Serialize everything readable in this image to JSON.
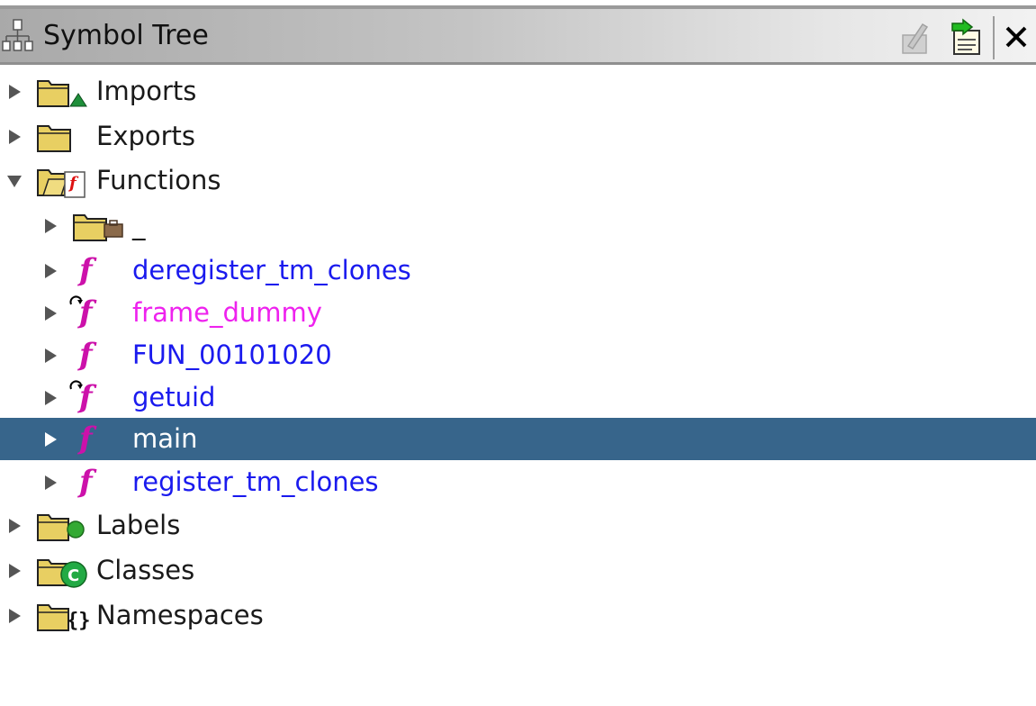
{
  "window": {
    "title": "Symbol Tree"
  },
  "toolbar": {
    "icons": [
      "edit-icon",
      "navigate-icon",
      "close-icon"
    ],
    "close_glyph": "✕"
  },
  "tree": {
    "imports": {
      "label": "Imports",
      "icon": "imports-folder-icon",
      "state": "collapsed"
    },
    "exports": {
      "label": "Exports",
      "icon": "exports-folder-icon",
      "state": "collapsed"
    },
    "functions": {
      "label": "Functions",
      "icon": "functions-folder-icon",
      "state": "expanded",
      "children": [
        {
          "label": "_",
          "kind": "folder",
          "icon": "package-folder-icon"
        },
        {
          "label": "deregister_tm_clones",
          "kind": "function",
          "icon": "function-icon",
          "color": "#1a1aee"
        },
        {
          "label": "frame_dummy",
          "kind": "thunk",
          "icon": "thunk-function-icon",
          "color": "#ee22ee"
        },
        {
          "label": "FUN_00101020",
          "kind": "function",
          "icon": "function-icon",
          "color": "#1a1aee"
        },
        {
          "label": "getuid",
          "kind": "thunk",
          "icon": "thunk-function-icon",
          "color": "#1a1aee"
        },
        {
          "label": "main",
          "kind": "function",
          "icon": "function-icon",
          "selected": true
        },
        {
          "label": "register_tm_clones",
          "kind": "function",
          "icon": "function-icon",
          "color": "#1a1aee"
        }
      ]
    },
    "labels": {
      "label": "Labels",
      "icon": "labels-folder-icon",
      "state": "collapsed"
    },
    "classes": {
      "label": "Classes",
      "icon": "classes-folder-icon",
      "state": "collapsed"
    },
    "namespaces": {
      "label": "Namespaces",
      "icon": "namespaces-folder-icon",
      "state": "collapsed"
    }
  },
  "colors": {
    "selection": "#37658b",
    "function_text": "#1a1aee",
    "thunk_text": "#ee22ee",
    "function_icon": "#cc11aa"
  }
}
